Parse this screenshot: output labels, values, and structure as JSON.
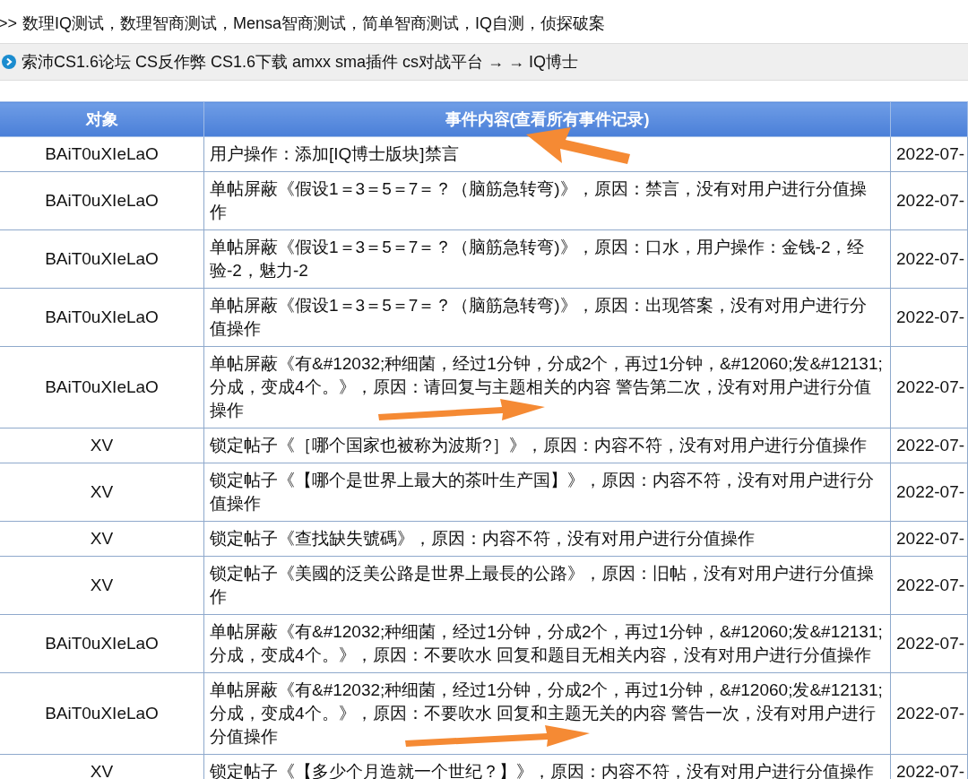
{
  "nav_line": {
    "prefix": ">>",
    "text": "数理IQ测试，数理智商测试，Mensa智商测试，简单智商测试，IQ自测，侦探破案"
  },
  "breadcrumb": {
    "text": "索沛CS1.6论坛 CS反作弊 CS1.6下载 amxx sma插件 cs对战平台 → → IQ博士"
  },
  "table": {
    "columns": [
      "对象",
      "事件内容(查看所有事件记录)"
    ],
    "rows": [
      {
        "object": "BAiT0uXIeLaO",
        "event": "用户操作：添加[IQ博士版块]禁言",
        "time": "2022-07-"
      },
      {
        "object": "BAiT0uXIeLaO",
        "event": "单帖屏蔽《假设1＝3＝5＝7＝？（脑筋急转弯)》，原因：禁言，没有对用户进行分值操作",
        "time": "2022-07-"
      },
      {
        "object": "BAiT0uXIeLaO",
        "event": "单帖屏蔽《假设1＝3＝5＝7＝？（脑筋急转弯)》，原因：口水，用户操作：金钱-2，经验-2，魅力-2",
        "time": "2022-07-"
      },
      {
        "object": "BAiT0uXIeLaO",
        "event": "单帖屏蔽《假设1＝3＝5＝7＝？（脑筋急转弯)》，原因：出现答案，没有对用户进行分值操作",
        "time": "2022-07-"
      },
      {
        "object": "BAiT0uXIeLaO",
        "event": "单帖屏蔽《有&#12032;种细菌，经过1分钟，分成2个，再过1分钟，&#12060;发&#12131;分成，变成4个。》，原因：请回复与主题相关的内容 警告第二次，没有对用户进行分值操作",
        "time": "2022-07-"
      },
      {
        "object": "XV",
        "event": "锁定帖子《［哪个国家也被称为波斯?］》，原因：内容不符，没有对用户进行分值操作",
        "time": "2022-07-"
      },
      {
        "object": "XV",
        "event": "锁定帖子《【哪个是世界上最大的茶叶生产国】》，原因：内容不符，没有对用户进行分值操作",
        "time": "2022-07-"
      },
      {
        "object": "XV",
        "event": "锁定帖子《查找缺失號碼》，原因：内容不符，没有对用户进行分值操作",
        "time": "2022-07-"
      },
      {
        "object": "XV",
        "event": "锁定帖子《美國的泛美公路是世界上最長的公路》，原因：旧帖，没有对用户进行分值操作",
        "time": "2022-07-"
      },
      {
        "object": "BAiT0uXIeLaO",
        "event": "单帖屏蔽《有&#12032;种细菌，经过1分钟，分成2个，再过1分钟，&#12060;发&#12131;分成，变成4个。》，原因：不要吹水 回复和题目无相关内容，没有对用户进行分值操作",
        "time": "2022-07-"
      },
      {
        "object": "BAiT0uXIeLaO",
        "event": "单帖屏蔽《有&#12032;种细菌，经过1分钟，分成2个，再过1分钟，&#12060;发&#12131;分成，变成4个。》，原因：不要吹水 回复和主题无关的内容 警告一次，没有对用户进行分值操作",
        "time": "2022-07-"
      },
      {
        "object": "XV",
        "event": "锁定帖子《【多少个月造就一个世纪？】》，原因：内容不符，没有对用户进行分值操作",
        "time": "2022-07-"
      }
    ]
  }
}
